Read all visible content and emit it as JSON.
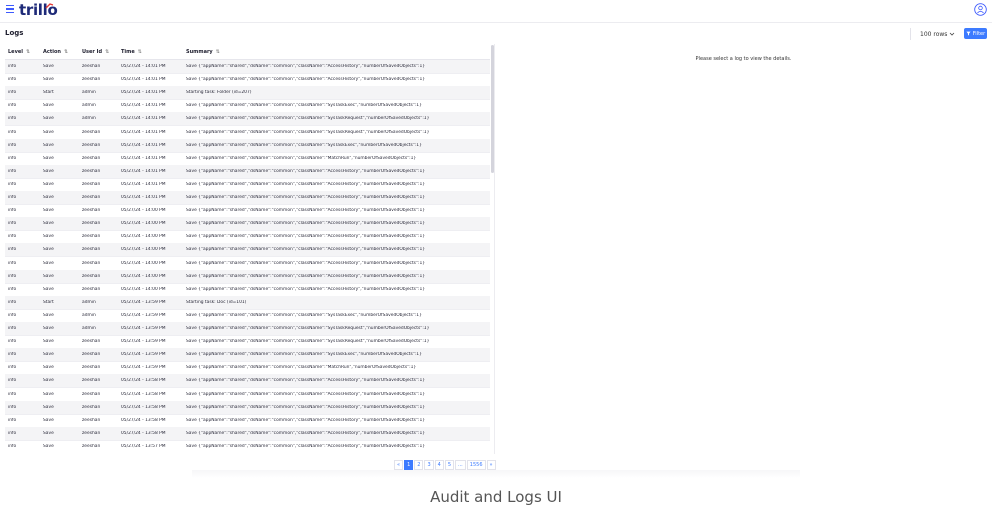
{
  "app": {
    "logo": "trillo"
  },
  "page": {
    "title": "Logs"
  },
  "toolbar": {
    "rows_label": "100 rows",
    "filter_label": "Filter"
  },
  "table": {
    "columns": [
      "Level",
      "Action",
      "User Id",
      "Time",
      "Summary"
    ],
    "rows": [
      [
        "info",
        "Save",
        "zeeshan",
        "05/27/24 - 14:01 PM",
        "Save {\"appName\":\"shared\",\"dsName\":\"common\",\"className\":\"AccessHistory\",\"numberOfSavedObjects\":1}"
      ],
      [
        "info",
        "Save",
        "zeeshan",
        "05/27/24 - 14:01 PM",
        "Save {\"appName\":\"shared\",\"dsName\":\"common\",\"className\":\"AccessHistory\",\"numberOfSavedObjects\":1}"
      ],
      [
        "info",
        "Start",
        "admin",
        "05/27/24 - 14:01 PM",
        "Starting task: Folder (id=207)"
      ],
      [
        "info",
        "Save",
        "admin",
        "05/27/24 - 14:01 PM",
        "Save {\"appName\":\"shared\",\"dsName\":\"common\",\"className\":\"SysTaskExec\",\"numberOfSavedObjects\":1}"
      ],
      [
        "info",
        "Save",
        "admin",
        "05/27/24 - 14:01 PM",
        "Save {\"appName\":\"shared\",\"dsName\":\"common\",\"className\":\"SysTaskRequest\",\"numberOfSavedObjects\":1}"
      ],
      [
        "info",
        "Save",
        "zeeshan",
        "05/27/24 - 14:01 PM",
        "Save {\"appName\":\"shared\",\"dsName\":\"common\",\"className\":\"SysTaskRequest\",\"numberOfSavedObjects\":1}"
      ],
      [
        "info",
        "Save",
        "zeeshan",
        "05/27/24 - 14:01 PM",
        "Save {\"appName\":\"shared\",\"dsName\":\"common\",\"className\":\"SysTaskExec\",\"numberOfSavedObjects\":1}"
      ],
      [
        "info",
        "Save",
        "zeeshan",
        "05/27/24 - 14:01 PM",
        "Save {\"appName\":\"shared\",\"dsName\":\"common\",\"className\":\"MatchRun\",\"numberOfSavedObjects\":1}"
      ],
      [
        "info",
        "Save",
        "zeeshan",
        "05/27/24 - 14:01 PM",
        "Save {\"appName\":\"shared\",\"dsName\":\"common\",\"className\":\"AccessHistory\",\"numberOfSavedObjects\":1}"
      ],
      [
        "info",
        "Save",
        "zeeshan",
        "05/27/24 - 14:01 PM",
        "Save {\"appName\":\"shared\",\"dsName\":\"common\",\"className\":\"AccessHistory\",\"numberOfSavedObjects\":1}"
      ],
      [
        "info",
        "Save",
        "zeeshan",
        "05/27/24 - 14:01 PM",
        "Save {\"appName\":\"shared\",\"dsName\":\"common\",\"className\":\"AccessHistory\",\"numberOfSavedObjects\":1}"
      ],
      [
        "info",
        "Save",
        "zeeshan",
        "05/27/24 - 14:00 PM",
        "Save {\"appName\":\"shared\",\"dsName\":\"common\",\"className\":\"AccessHistory\",\"numberOfSavedObjects\":1}"
      ],
      [
        "info",
        "Save",
        "zeeshan",
        "05/27/24 - 14:00 PM",
        "Save {\"appName\":\"shared\",\"dsName\":\"common\",\"className\":\"AccessHistory\",\"numberOfSavedObjects\":1}"
      ],
      [
        "info",
        "Save",
        "zeeshan",
        "05/27/24 - 14:00 PM",
        "Save {\"appName\":\"shared\",\"dsName\":\"common\",\"className\":\"AccessHistory\",\"numberOfSavedObjects\":1}"
      ],
      [
        "info",
        "Save",
        "zeeshan",
        "05/27/24 - 14:00 PM",
        "Save {\"appName\":\"shared\",\"dsName\":\"common\",\"className\":\"AccessHistory\",\"numberOfSavedObjects\":1}"
      ],
      [
        "info",
        "Save",
        "zeeshan",
        "05/27/24 - 14:00 PM",
        "Save {\"appName\":\"shared\",\"dsName\":\"common\",\"className\":\"AccessHistory\",\"numberOfSavedObjects\":1}"
      ],
      [
        "info",
        "Save",
        "zeeshan",
        "05/27/24 - 14:00 PM",
        "Save {\"appName\":\"shared\",\"dsName\":\"common\",\"className\":\"AccessHistory\",\"numberOfSavedObjects\":1}"
      ],
      [
        "info",
        "Save",
        "zeeshan",
        "05/27/24 - 14:00 PM",
        "Save {\"appName\":\"shared\",\"dsName\":\"common\",\"className\":\"AccessHistory\",\"numberOfSavedObjects\":1}"
      ],
      [
        "info",
        "Start",
        "admin",
        "05/27/24 - 13:59 PM",
        "Starting task: Doc (id=101)"
      ],
      [
        "info",
        "Save",
        "admin",
        "05/27/24 - 13:59 PM",
        "Save {\"appName\":\"shared\",\"dsName\":\"common\",\"className\":\"SysTaskExec\",\"numberOfSavedObjects\":1}"
      ],
      [
        "info",
        "Save",
        "admin",
        "05/27/24 - 13:59 PM",
        "Save {\"appName\":\"shared\",\"dsName\":\"common\",\"className\":\"SysTaskRequest\",\"numberOfSavedObjects\":1}"
      ],
      [
        "info",
        "Save",
        "zeeshan",
        "05/27/24 - 13:59 PM",
        "Save {\"appName\":\"shared\",\"dsName\":\"common\",\"className\":\"SysTaskRequest\",\"numberOfSavedObjects\":1}"
      ],
      [
        "info",
        "Save",
        "zeeshan",
        "05/27/24 - 13:59 PM",
        "Save {\"appName\":\"shared\",\"dsName\":\"common\",\"className\":\"SysTaskExec\",\"numberOfSavedObjects\":1}"
      ],
      [
        "info",
        "Save",
        "zeeshan",
        "05/27/24 - 13:59 PM",
        "Save {\"appName\":\"shared\",\"dsName\":\"common\",\"className\":\"MatchRun\",\"numberOfSavedObjects\":1}"
      ],
      [
        "info",
        "Save",
        "zeeshan",
        "05/27/24 - 13:58 PM",
        "Save {\"appName\":\"shared\",\"dsName\":\"common\",\"className\":\"AccessHistory\",\"numberOfSavedObjects\":1}"
      ],
      [
        "info",
        "Save",
        "zeeshan",
        "05/27/24 - 13:58 PM",
        "Save {\"appName\":\"shared\",\"dsName\":\"common\",\"className\":\"AccessHistory\",\"numberOfSavedObjects\":1}"
      ],
      [
        "info",
        "Save",
        "zeeshan",
        "05/27/24 - 13:58 PM",
        "Save {\"appName\":\"shared\",\"dsName\":\"common\",\"className\":\"AccessHistory\",\"numberOfSavedObjects\":1}"
      ],
      [
        "info",
        "Save",
        "zeeshan",
        "05/27/24 - 13:58 PM",
        "Save {\"appName\":\"shared\",\"dsName\":\"common\",\"className\":\"AccessHistory\",\"numberOfSavedObjects\":1}"
      ],
      [
        "info",
        "Save",
        "zeeshan",
        "05/27/24 - 13:58 PM",
        "Save {\"appName\":\"shared\",\"dsName\":\"common\",\"className\":\"AccessHistory\",\"numberOfSavedObjects\":1}"
      ],
      [
        "info",
        "Save",
        "zeeshan",
        "05/27/24 - 13:57 PM",
        "Save {\"appName\":\"shared\",\"dsName\":\"common\",\"className\":\"AccessHistory\",\"numberOfSavedObjects\":1}"
      ]
    ]
  },
  "details": {
    "placeholder": "Please select a log to view the details."
  },
  "pagination": {
    "prev": "«",
    "pages": [
      "1",
      "2",
      "3",
      "4",
      "5"
    ],
    "ellipsis": "...",
    "last": "1556",
    "next": "»",
    "current": "1"
  },
  "caption": "Audit and Logs UI",
  "colors": {
    "accent": "#3d7bff",
    "logo": "#1e2a78",
    "alt_row": "#f4f4f6"
  },
  "icons": {
    "menu": "hamburger-menu-icon",
    "user": "user-circle-icon",
    "filter": "filter-funnel-icon",
    "sort": "sort-arrows-icon",
    "dropdown": "chevron-down-icon"
  }
}
